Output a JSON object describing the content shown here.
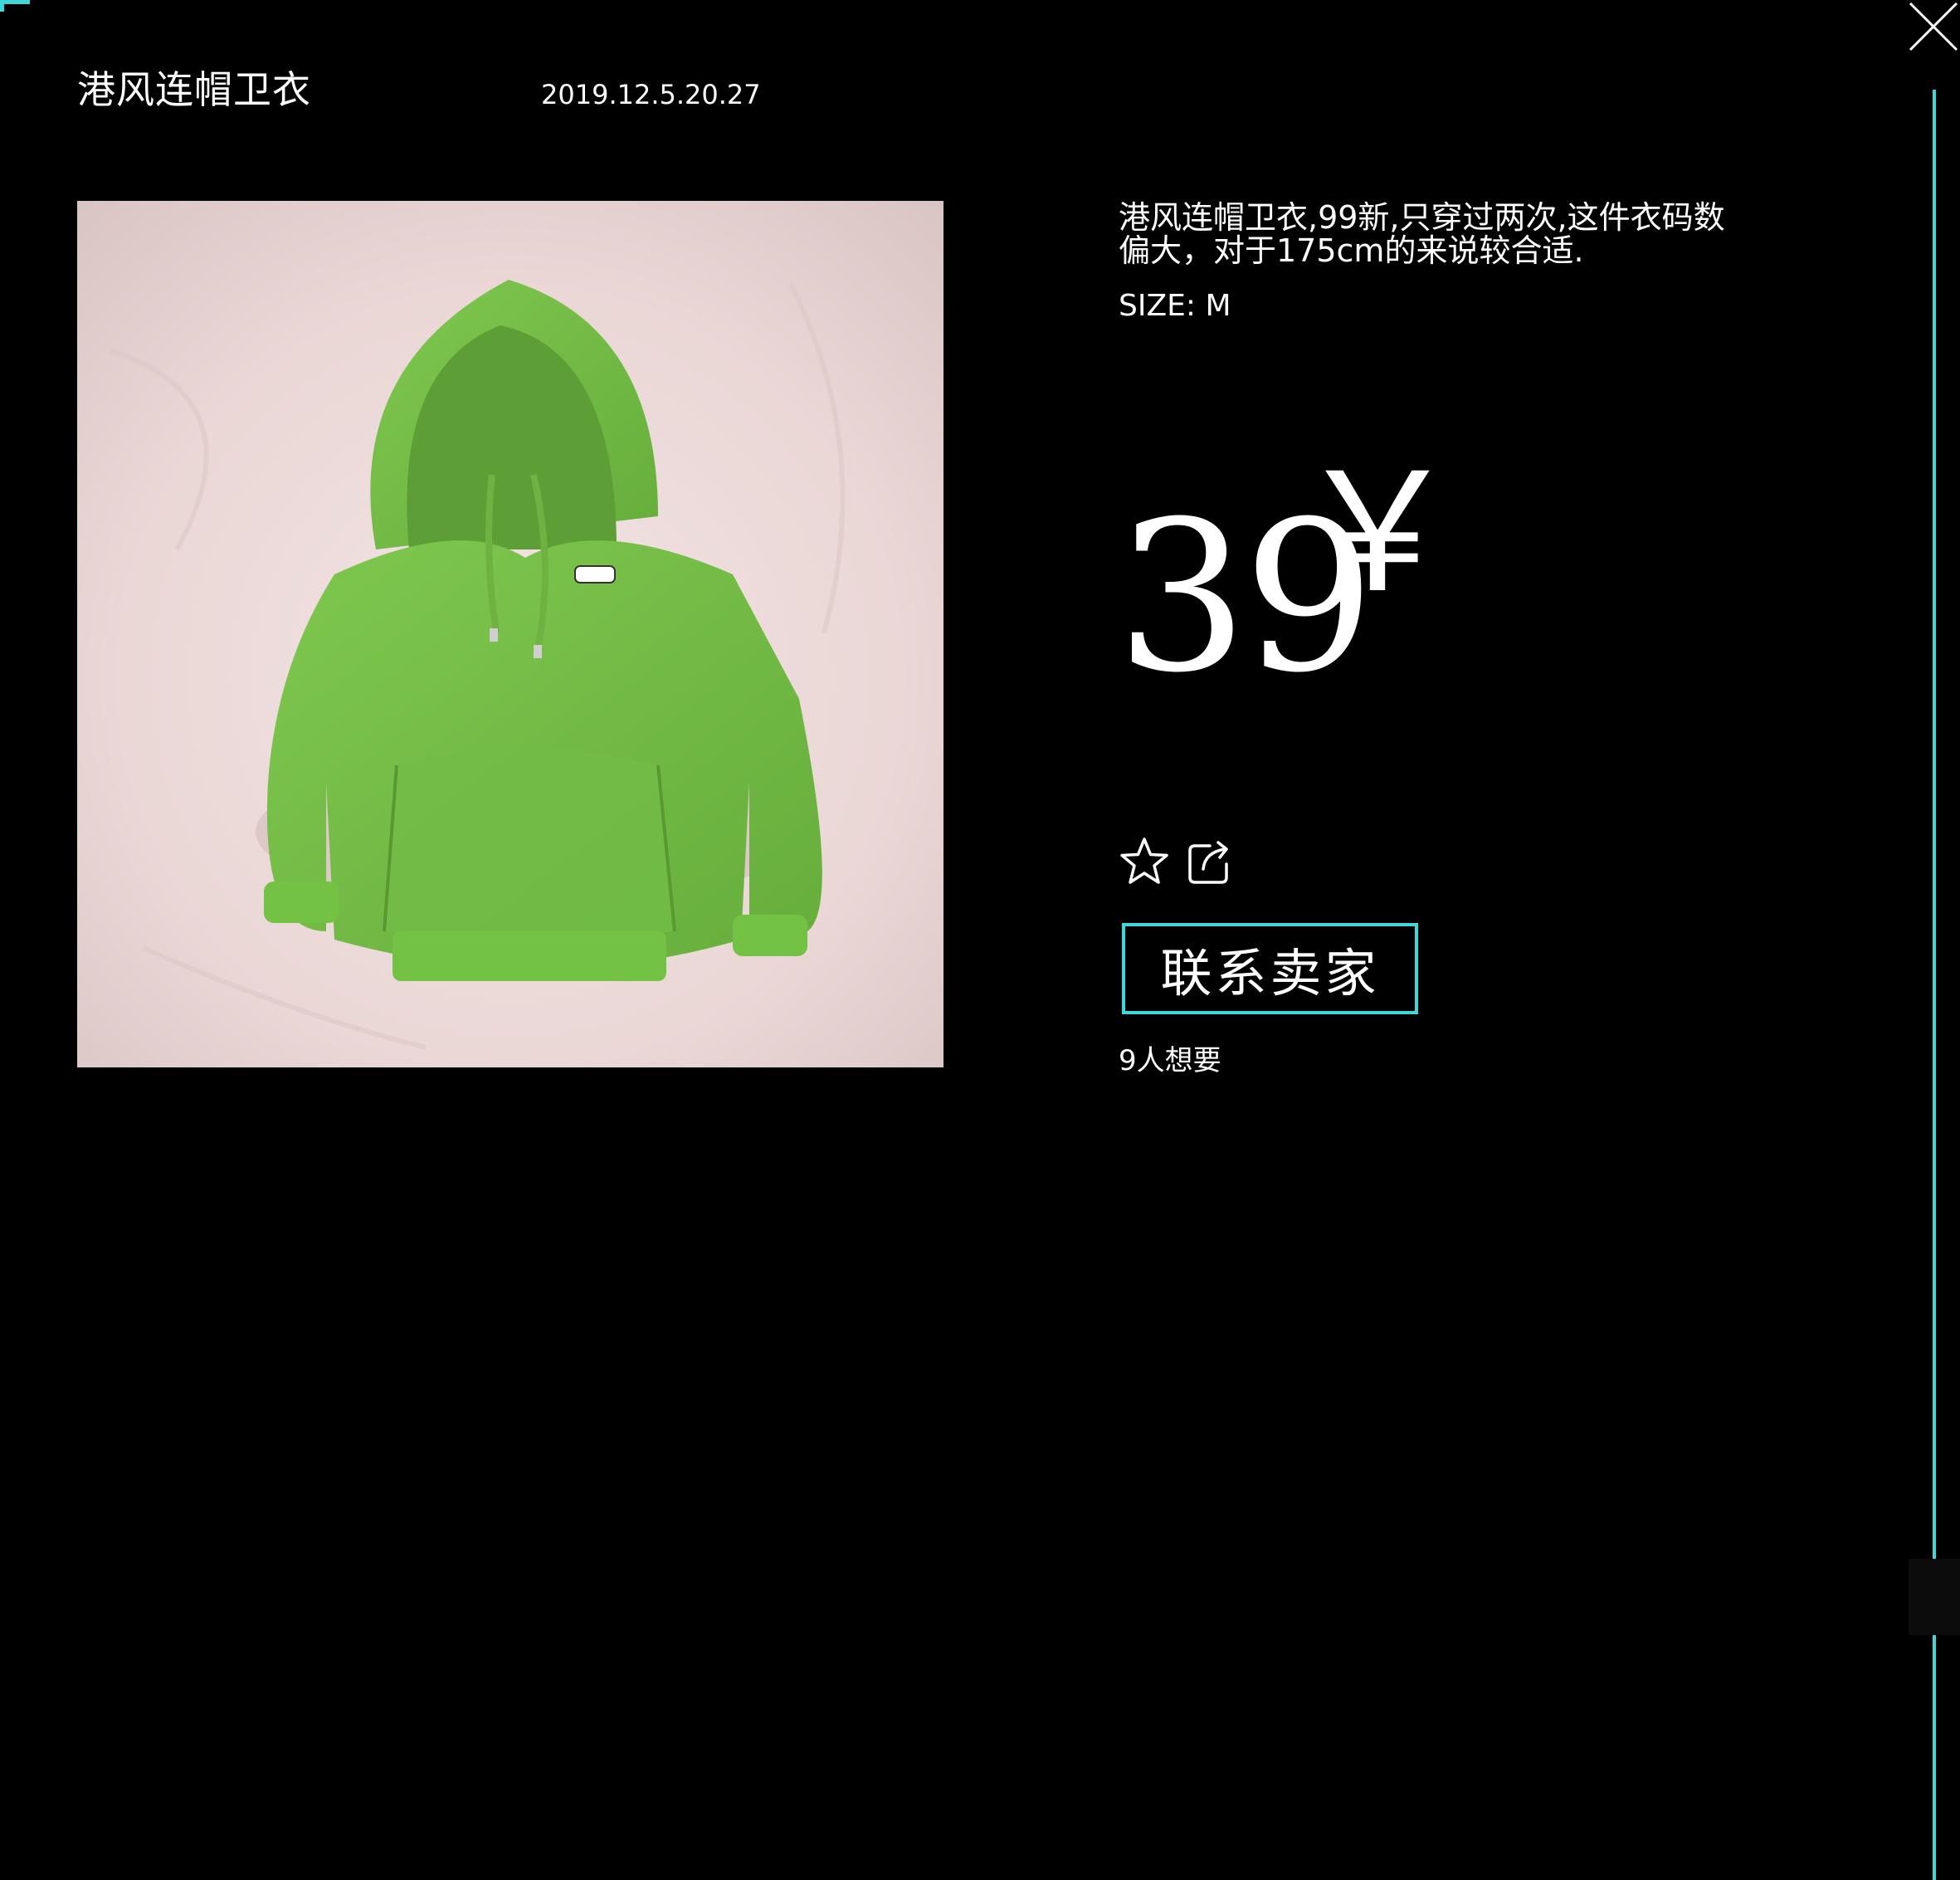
{
  "listing": {
    "title": "港风连帽卫衣",
    "date": "2019.12.5.20.27",
    "description": "港风连帽卫衣,99新,只穿过两次,这件衣码数偏大，对于175cm的来说较合适.",
    "size": "SIZE: M",
    "price": "39",
    "currency": "￥",
    "contact_label": "联系卖家",
    "want_count": "9人想要"
  },
  "icons": {
    "close": "close-icon",
    "favorite": "star-icon",
    "share": "share-icon"
  },
  "colors": {
    "background": "#000000",
    "accent": "#3fd8d8",
    "text": "#ffffff",
    "hoodie": "#78c24a"
  }
}
